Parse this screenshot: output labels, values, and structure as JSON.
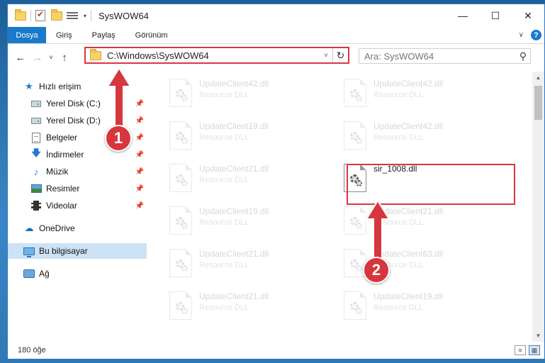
{
  "window": {
    "title": "SysWOW64"
  },
  "ribbon": {
    "tabs": [
      "Dosya",
      "Giriş",
      "Paylaş",
      "Görünüm"
    ],
    "help": "?"
  },
  "nav": {
    "address": "C:\\Windows\\SysWOW64",
    "search_placeholder": "Ara: SysWOW64"
  },
  "sidebar": {
    "items": [
      {
        "label": "Hızlı erişim",
        "icon": "star-icon"
      },
      {
        "label": "Yerel Disk (C:)",
        "icon": "drive-icon",
        "pinned": true
      },
      {
        "label": "Yerel Disk (D:)",
        "icon": "drive-icon",
        "pinned": true
      },
      {
        "label": "Belgeler",
        "icon": "document-icon",
        "pinned": true
      },
      {
        "label": "İndirmeler",
        "icon": "download-icon",
        "pinned": true
      },
      {
        "label": "Müzik",
        "icon": "music-icon",
        "pinned": true
      },
      {
        "label": "Resimler",
        "icon": "pictures-icon",
        "pinned": true
      },
      {
        "label": "Videolar",
        "icon": "video-icon",
        "pinned": true
      },
      {
        "label": "OneDrive",
        "icon": "cloud-icon"
      },
      {
        "label": "Bu bilgisayar",
        "icon": "computer-icon",
        "selected": true
      },
      {
        "label": "Ağ",
        "icon": "network-icon"
      }
    ]
  },
  "files": {
    "left_col": [
      {
        "name": "UpdateClient42.dll",
        "desc": "Resource DLL"
      },
      {
        "name": "UpdateClient19.dll",
        "desc": "Resource DLL"
      },
      {
        "name": "UpdateClient21.dll",
        "desc": "Resource DLL"
      },
      {
        "name": "UpdateClient19.dll",
        "desc": "Resource DLL"
      },
      {
        "name": "UpdateClient21.dll",
        "desc": "Resource DLL"
      },
      {
        "name": "UpdateClient21.dll",
        "desc": "Resource DLL"
      }
    ],
    "right_col": [
      {
        "name": "UpdateClient42.dll",
        "desc": "Resource DLL"
      },
      {
        "name": "UpdateClient42.dll",
        "desc": "Resource DLL"
      },
      {
        "name": "sir_1008.dll",
        "desc": "",
        "highlighted": true
      },
      {
        "name": "UpdateClient21.dll",
        "desc": "Resource DLL"
      },
      {
        "name": "UpdateClient63.dll",
        "desc": "Resource DLL"
      },
      {
        "name": "UpdateClient19.dll",
        "desc": "Resource DLL"
      }
    ]
  },
  "status": {
    "count": "180 öğe"
  },
  "annotations": {
    "step1": "1",
    "step2": "2",
    "color": "#d6373f"
  }
}
